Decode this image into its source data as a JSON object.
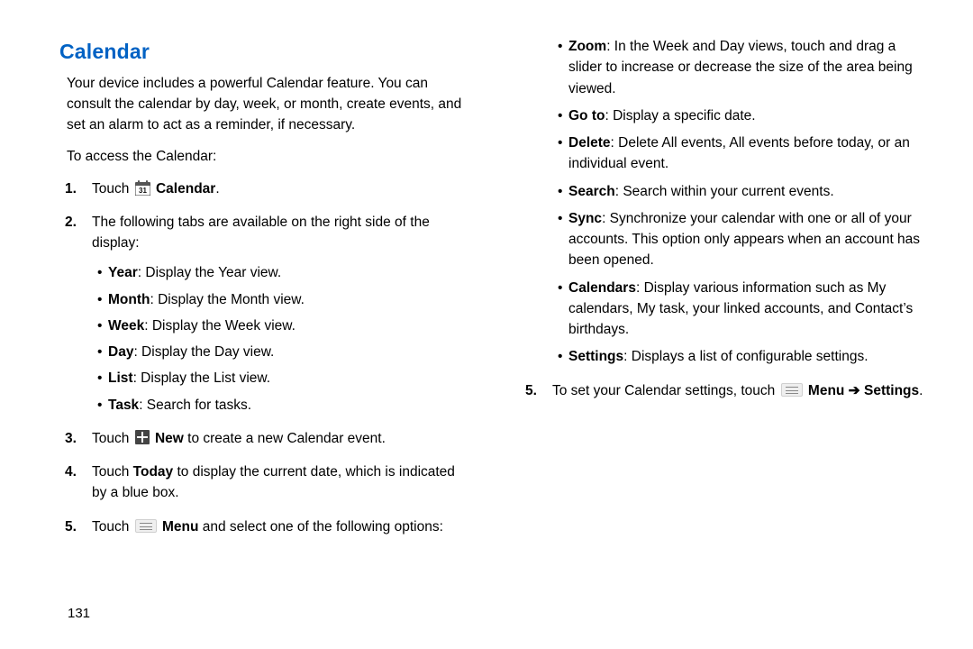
{
  "heading": "Calendar",
  "intro": "Your device includes a powerful Calendar feature. You can consult the calendar by day, week, or month, create events, and set an alarm to act as a reminder, if necessary.",
  "lead": "To access the Calendar:",
  "step1_prefix": "Touch ",
  "step1_suffix": "Calendar",
  "step1_period": ".",
  "step2_text": "The following tabs are available on the right side of the display:",
  "tabs": {
    "year": {
      "name": "Year",
      "desc": ": Display the Year view."
    },
    "month": {
      "name": "Month",
      "desc": ": Display the Month view."
    },
    "week": {
      "name": "Week",
      "desc": ": Display the Week view."
    },
    "day": {
      "name": "Day",
      "desc": ": Display the Day view."
    },
    "list": {
      "name": "List",
      "desc": ": Display the List view."
    },
    "task": {
      "name": "Task",
      "desc": ": Search for tasks."
    }
  },
  "step3_prefix": "Touch ",
  "step3_new": "New",
  "step3_suffix": " to create a new Calendar event.",
  "step4_prefix": "Touch ",
  "step4_today": "Today",
  "step4_suffix": " to display the current date, which is indicated by a blue box.",
  "step5_prefix": "Touch ",
  "step5_menu": "Menu",
  "step5_suffix": " and select one of the following options:",
  "options": {
    "zoom": {
      "name": "Zoom",
      "desc": ": In the Week and Day views, touch and drag a slider to increase or decrease the size of the area being viewed."
    },
    "goto": {
      "name": "Go to",
      "desc": ": Display a specific date."
    },
    "delete": {
      "name": "Delete",
      "desc": ": Delete All events, All events before today, or an individual event."
    },
    "search": {
      "name": "Search",
      "desc": ": Search within your current events."
    },
    "sync": {
      "name": "Sync",
      "desc": ": Synchronize your calendar with one or all of your accounts. This option only appears when an account has been opened."
    },
    "calendars": {
      "name": "Calendars",
      "desc": ": Display various information such as My calendars, My task, your linked accounts, and Contact’s birthdays."
    },
    "settings": {
      "name": "Settings",
      "desc": ": Displays a list of configurable settings."
    }
  },
  "step6_prefix": "To set your Calendar settings, touch ",
  "step6_menu": "Menu",
  "step6_arrow": " ➔ ",
  "step6_settings": "Settings",
  "step6_period": ".",
  "page_number": "131",
  "calendar_day": "31"
}
